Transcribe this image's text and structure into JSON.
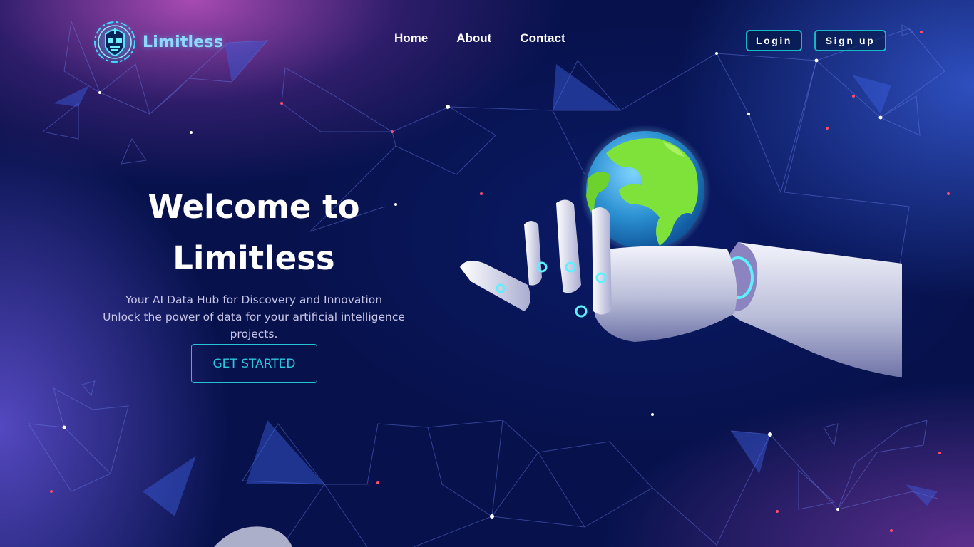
{
  "brand": {
    "name": "Limitless",
    "logo_icon": "robot-head-icon",
    "accent_color": "#18b7c4",
    "logo_text_color": "#8fd8ff"
  },
  "nav": {
    "items": [
      {
        "label": "Home"
      },
      {
        "label": "About"
      },
      {
        "label": "Contact"
      }
    ]
  },
  "auth": {
    "login_label": "Login",
    "signup_label": "Sign up"
  },
  "hero": {
    "title_line1": "Welcome to",
    "title_line2": "Limitless",
    "subtitle": "Your AI Data Hub for Discovery and Innovation",
    "description": "Unlock the power of data for your artificial intelligence projects.",
    "cta_label": "GET STARTED",
    "illustration": "robot-hand-holding-earth"
  },
  "theme": {
    "background": "#07124d",
    "glow_purple": "#c454c4",
    "glow_blue": "#3c64e6",
    "network_line": "#6a7fe8",
    "node_red": "#ff4d6d"
  }
}
